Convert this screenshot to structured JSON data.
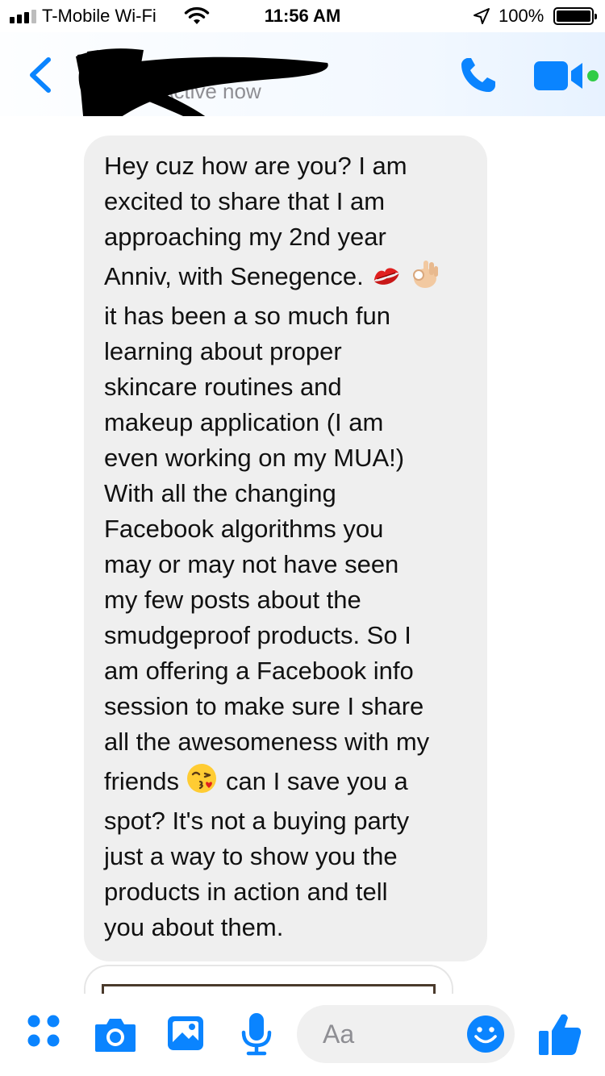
{
  "status_bar": {
    "carrier": "T-Mobile Wi-Fi",
    "time": "11:56 AM",
    "battery": "100%",
    "signal_bars_filled": 3,
    "signal_bars_total": 4
  },
  "header": {
    "contact_name": "",
    "presence": "Active now",
    "icons": {
      "back": "chevron-left-icon",
      "call": "phone-icon",
      "video": "video-camera-icon"
    }
  },
  "thread": {
    "message_lines": [
      "Hey cuz how are you? I am",
      "excited to share that I am",
      "approaching my 2nd year",
      "Anniv, with Senegence.",
      "it has been a so much fun",
      "learning about proper",
      "skincare routines and",
      "makeup application (I am",
      "even working on my MUA!)",
      "With all the changing",
      "Facebook algorithms you",
      "may or may not have seen",
      "my few posts about the",
      "smudgeproof products. So I",
      "am offering a Facebook info",
      "session to make sure I share",
      "all the awesomeness with my",
      "friends",
      "can I save you a",
      "spot? It's not a buying party",
      "just a way to show you the",
      "products in action and tell",
      "you about them."
    ],
    "inline_emojis": [
      "kiss-mark-emoji",
      "ok-hand-emoji",
      "face-blowing-kiss-emoji"
    ]
  },
  "composer": {
    "placeholder": "Aa",
    "icons": [
      "apps-grid-icon",
      "camera-icon",
      "photo-gallery-icon",
      "microphone-icon",
      "emoji-icon",
      "thumbs-up-icon"
    ]
  },
  "colors": {
    "accent": "#0a84ff",
    "bubble": "#efefef",
    "header_gradient_end": "#e7f2ff",
    "presence_dot": "#31cc46"
  }
}
